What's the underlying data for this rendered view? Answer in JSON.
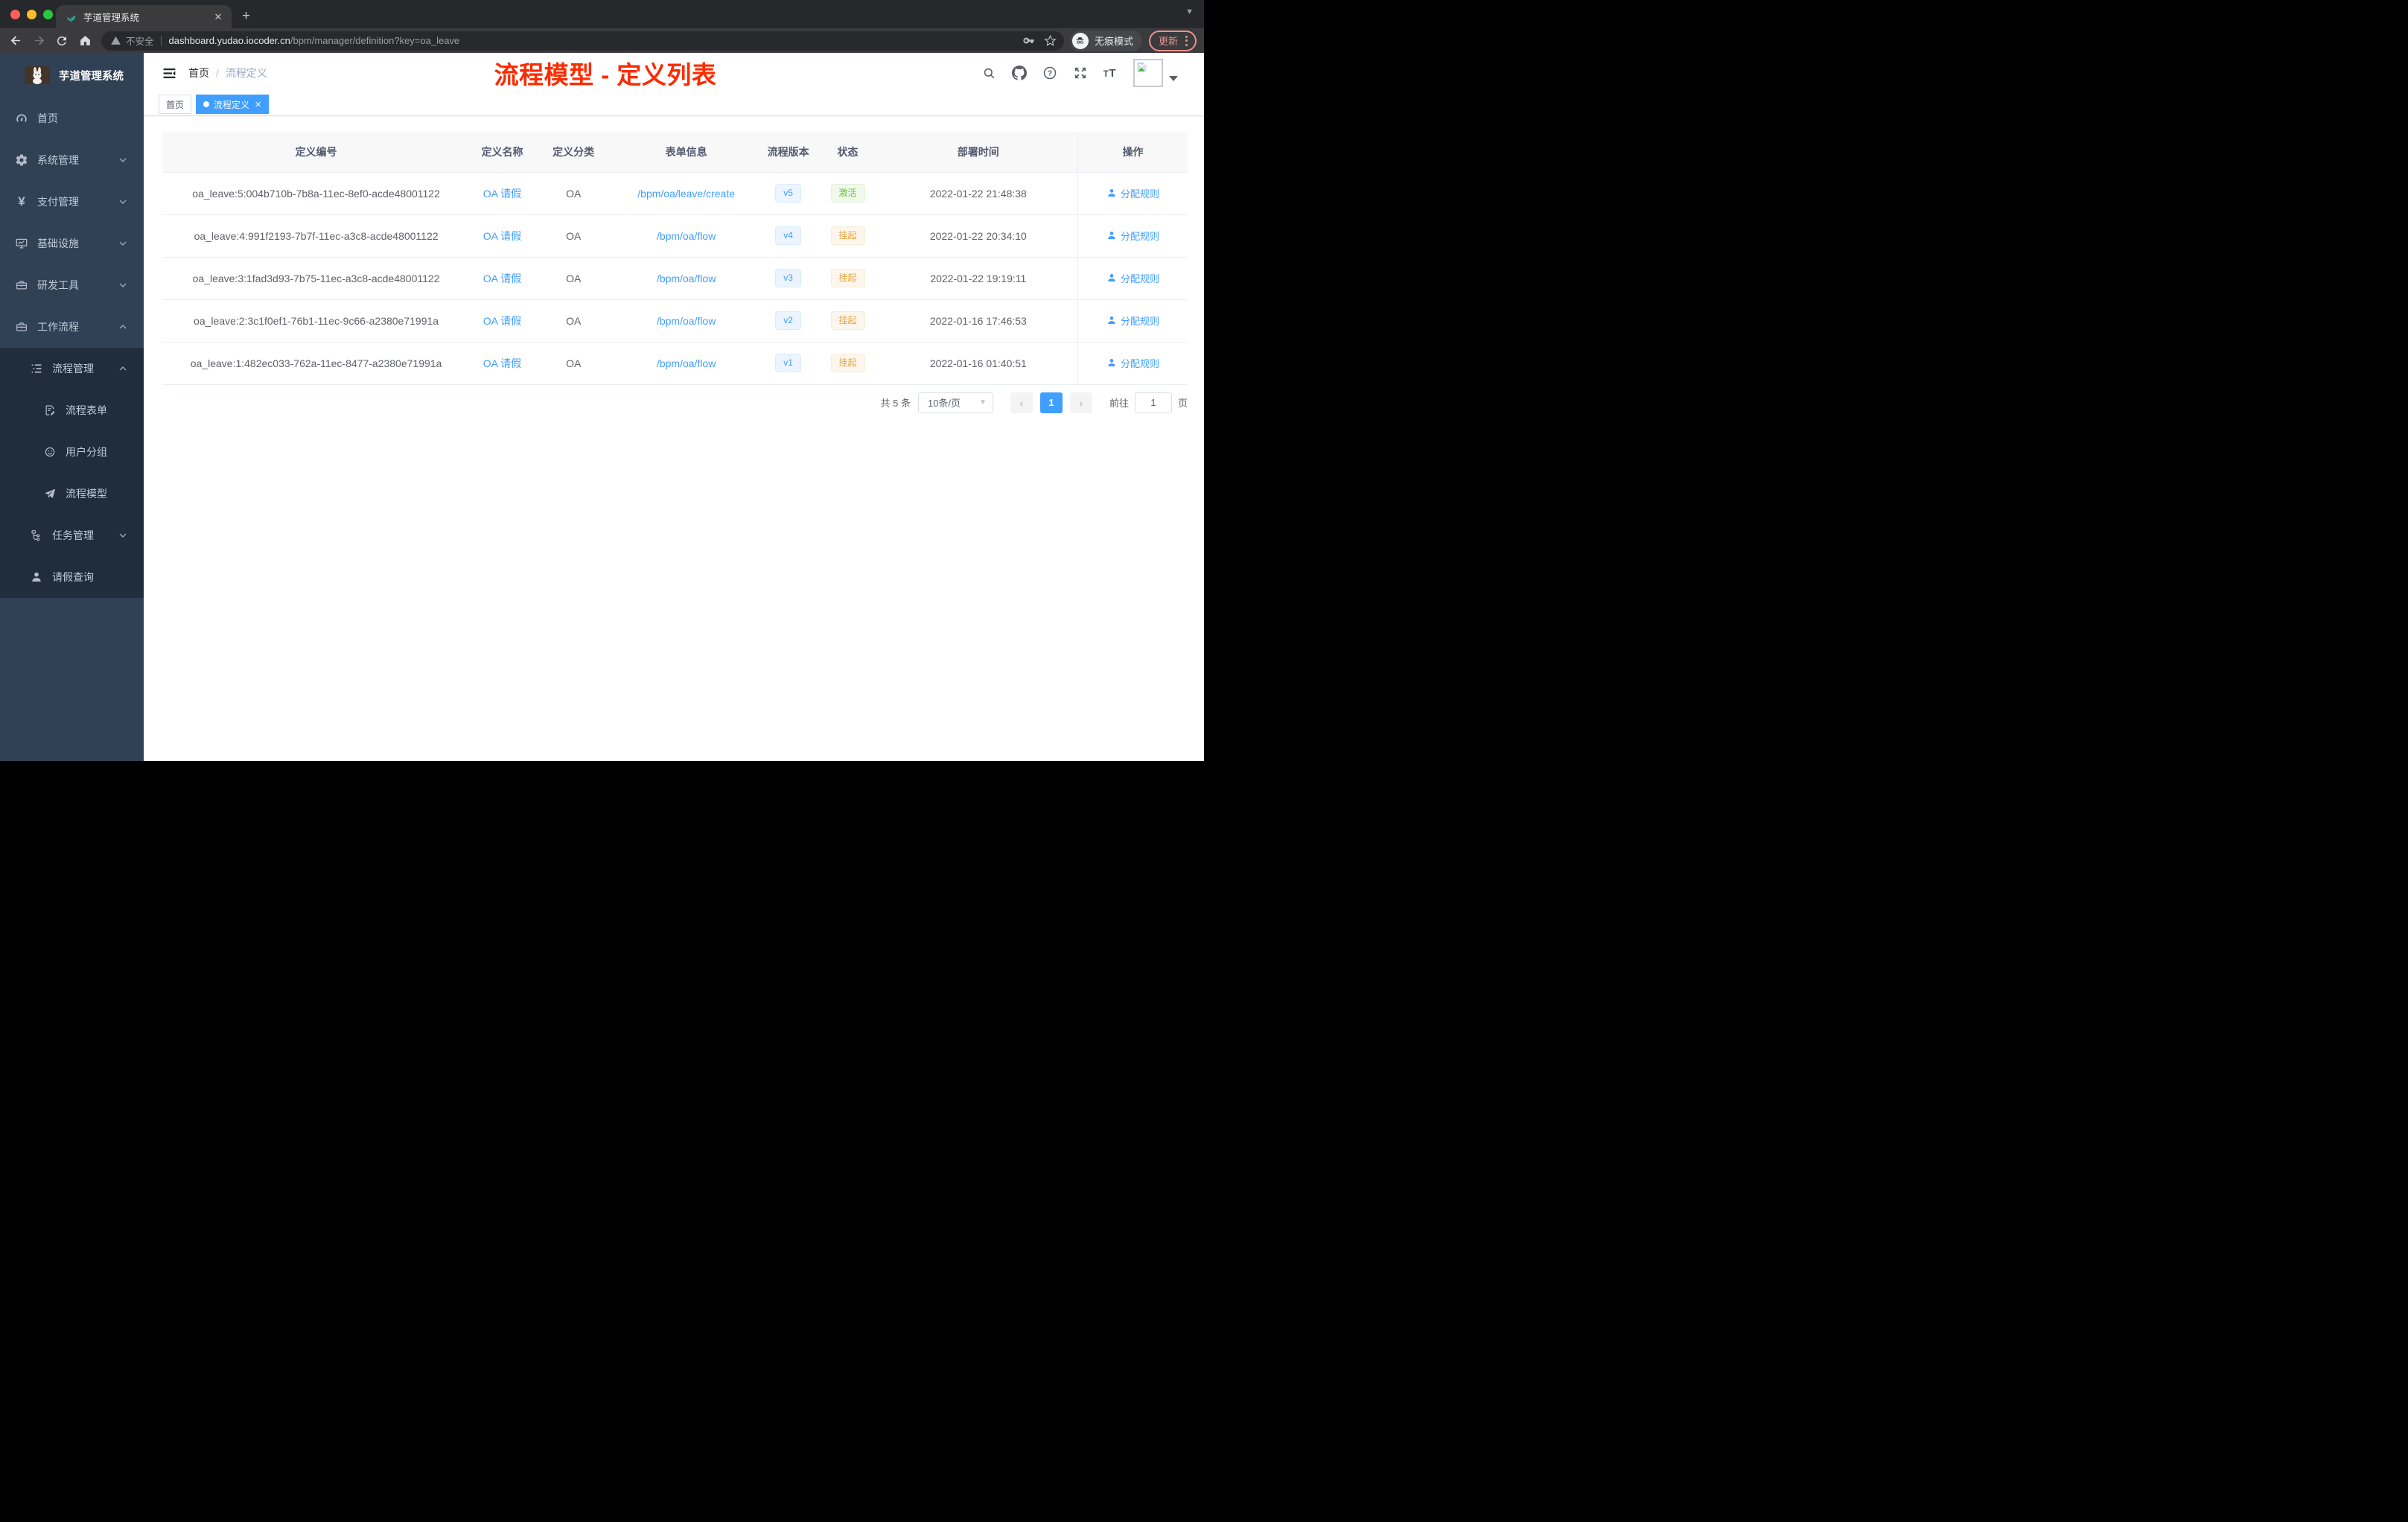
{
  "colors": {
    "accent": "#409eff",
    "success": "#67c23a",
    "warning": "#e6a23c",
    "annotation_red": "#fb2b00",
    "sidebar_bg": "#304156",
    "submenu_bg": "#1f2d3d"
  },
  "browser": {
    "tab_title": "芋道管理系统",
    "new_tab_label": "+",
    "security_label": "不安全",
    "url_host": "dashboard.yudao.iocoder.cn",
    "url_path": "/bpm/manager/definition?key=oa_leave",
    "incognito_label": "无痕模式",
    "update_label": "更新"
  },
  "sidebar": {
    "app_title": "芋道管理系统",
    "items": [
      {
        "label": "首页"
      },
      {
        "label": "系统管理"
      },
      {
        "label": "支付管理"
      },
      {
        "label": "基础设施"
      },
      {
        "label": "研发工具"
      },
      {
        "label": "工作流程"
      },
      {
        "label": "流程管理"
      },
      {
        "label": "流程表单"
      },
      {
        "label": "用户分组"
      },
      {
        "label": "流程模型"
      },
      {
        "label": "任务管理"
      },
      {
        "label": "请假查询"
      }
    ]
  },
  "header": {
    "breadcrumb_home": "首页",
    "breadcrumb_current": "流程定义",
    "annotation": "流程模型 - 定义列表"
  },
  "tags": {
    "home": "首页",
    "active": "流程定义"
  },
  "table": {
    "columns": [
      "定义编号",
      "定义名称",
      "定义分类",
      "表单信息",
      "流程版本",
      "状态",
      "部署时间",
      "操作"
    ],
    "rows": [
      {
        "id": "oa_leave:5:004b710b-7b8a-11ec-8ef0-acde48001122",
        "name": "OA 请假",
        "category": "OA",
        "form": "/bpm/oa/leave/create",
        "version": "v5",
        "status": "激活",
        "deploy_time": "2022-01-22 21:48:38",
        "action": "分配规则"
      },
      {
        "id": "oa_leave:4:991f2193-7b7f-11ec-a3c8-acde48001122",
        "name": "OA 请假",
        "category": "OA",
        "form": "/bpm/oa/flow",
        "version": "v4",
        "status": "挂起",
        "deploy_time": "2022-01-22 20:34:10",
        "action": "分配规则"
      },
      {
        "id": "oa_leave:3:1fad3d93-7b75-11ec-a3c8-acde48001122",
        "name": "OA 请假",
        "category": "OA",
        "form": "/bpm/oa/flow",
        "version": "v3",
        "status": "挂起",
        "deploy_time": "2022-01-22 19:19:11",
        "action": "分配规则"
      },
      {
        "id": "oa_leave:2:3c1f0ef1-76b1-11ec-9c66-a2380e71991a",
        "name": "OA 请假",
        "category": "OA",
        "form": "/bpm/oa/flow",
        "version": "v2",
        "status": "挂起",
        "deploy_time": "2022-01-16 17:46:53",
        "action": "分配规则"
      },
      {
        "id": "oa_leave:1:482ec033-762a-11ec-8477-a2380e71991a",
        "name": "OA 请假",
        "category": "OA",
        "form": "/bpm/oa/flow",
        "version": "v1",
        "status": "挂起",
        "deploy_time": "2022-01-16 01:40:51",
        "action": "分配规则"
      }
    ]
  },
  "pagination": {
    "total_label": "共 5 条",
    "page_size_label": "10条/页",
    "current_page": "1",
    "goto_label": "前往",
    "goto_value": "1",
    "page_unit_label": "页"
  }
}
